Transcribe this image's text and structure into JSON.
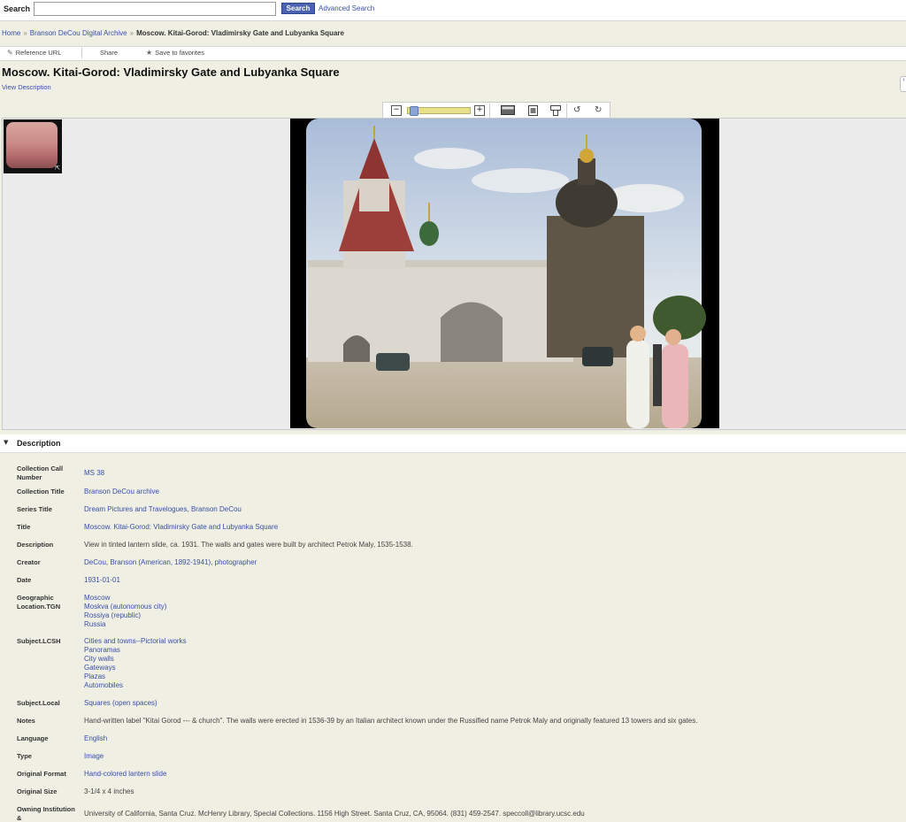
{
  "search": {
    "label": "Search",
    "value": "",
    "button_label": "Search",
    "advanced_label": "Advanced Search"
  },
  "breadcrumb": {
    "home": "Home",
    "collection": "Branson DeCou Digital Archive",
    "current": "Moscow. Kitai-Gorod: Vladimirsky Gate and Lubyanka Square",
    "separator": "»"
  },
  "actions": {
    "reference_url": "Reference URL",
    "share": "Share",
    "save_favorites": "Save to favorites"
  },
  "page": {
    "title": "Moscow. Kitai-Gorod: Vladimirsky Gate and Lubyanka Square",
    "view_description": "View Description"
  },
  "toolbar": {
    "zoom_out": "−",
    "zoom_in": "+",
    "zoom_level": 0.05
  },
  "description": {
    "header": "Description",
    "fields": [
      {
        "label": "Collection Call Number",
        "values": [
          "MS 38"
        ],
        "link": true
      },
      {
        "label": "Collection Title",
        "values": [
          "Branson DeCou archive"
        ],
        "link": true
      },
      {
        "label": "Series Title",
        "values": [
          "Dream Pictures and Travelogues, Branson DeCou"
        ],
        "link": true
      },
      {
        "label": "Title",
        "values": [
          "Moscow. Kitai-Gorod: Vladimirsky Gate and Lubyanka Square"
        ],
        "link": true
      },
      {
        "label": "Description",
        "values": [
          "View in tinted lantern slide, ca. 1931. The walls and gates were built by architect Petrok Maly, 1535-1538."
        ],
        "link": false
      },
      {
        "label": "Creator",
        "values": [
          "DeCou, Branson (American, 1892-1941), photographer"
        ],
        "link": true
      },
      {
        "label": "Date",
        "values": [
          "1931-01-01"
        ],
        "link": true
      },
      {
        "label": "Geographic Location.TGN",
        "values": [
          "Moscow",
          "Moskva (autonomous city)",
          "Rossiya (republic)",
          "Russia"
        ],
        "link": true
      },
      {
        "label": "Subject.LCSH",
        "values": [
          "Cities and towns--Pictorial works",
          "Panoramas",
          "City walls",
          "Gateways",
          "Plazas",
          "Automobiles"
        ],
        "link": true
      },
      {
        "label": "Subject.Local",
        "values": [
          "Squares (open spaces)"
        ],
        "link": true
      },
      {
        "label": "Notes",
        "values": [
          "Hand-written label \"Kitai Gorod --- & church\". The walls were erected in 1536-39 by an Italian architect known under the Russified name Petrok Maly and originally featured 13 towers and six gates."
        ],
        "link": false
      },
      {
        "label": "Language",
        "values": [
          "English"
        ],
        "link": true
      },
      {
        "label": "Type",
        "values": [
          "Image"
        ],
        "link": true
      },
      {
        "label": "Original Format",
        "values": [
          "Hand-colored lantern slide"
        ],
        "link": true
      },
      {
        "label": "Original Size",
        "values": [
          "3-1/4 x 4 inches"
        ],
        "link": false
      },
      {
        "label": "Owning Institution &",
        "values": [
          "University of California, Santa Cruz. McHenry Library, Special Collections. 1156 High Street. Santa Cruz, CA, 95064. (831) 459-2547. speccoll@library.ucsc.edu"
        ],
        "link": false
      }
    ]
  }
}
